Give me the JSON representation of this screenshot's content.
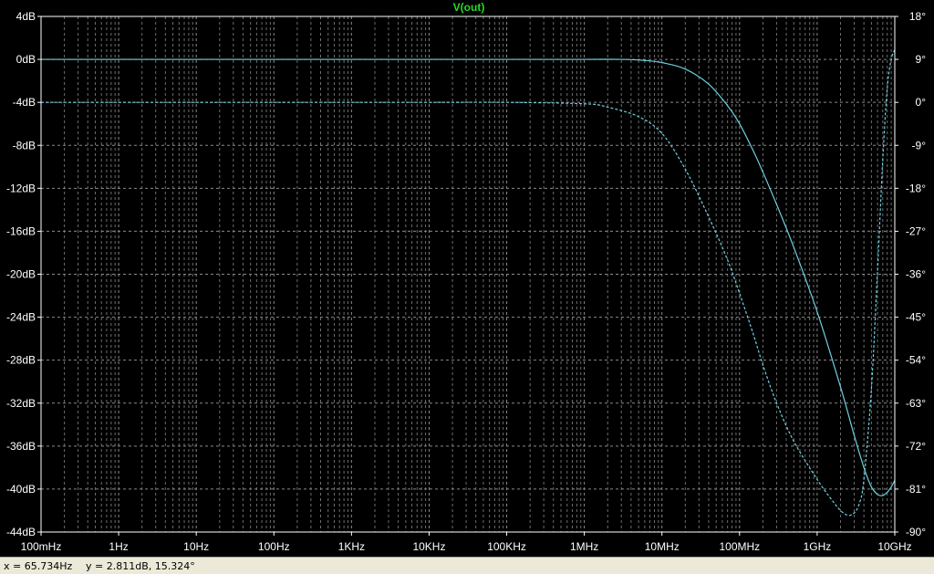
{
  "colors": {
    "background": "#000000",
    "axis": "#ffffff",
    "grid": "#8a8a8a",
    "trace": "#6fcfe0",
    "title": "#22dd22"
  },
  "status": {
    "x_readout": "x = 65.734Hz",
    "y_readout": "y = 2.811dB, 15.324°"
  },
  "chart_data": {
    "type": "line",
    "title": "V(out)",
    "x_scale": "log",
    "xlim": [
      0.1,
      10000000000
    ],
    "x_ticks": [
      0.1,
      1,
      10,
      100,
      1000,
      10000,
      100000,
      1000000,
      10000000,
      100000000,
      1000000000,
      10000000000
    ],
    "x_tick_labels": [
      "100mHz",
      "1Hz",
      "10Hz",
      "100Hz",
      "1KHz",
      "10KHz",
      "100KHz",
      "1MHz",
      "10MHz",
      "100MHz",
      "1GHz",
      "10GHz"
    ],
    "ylim": [
      -44,
      4
    ],
    "y_ticks": [
      4,
      0,
      -4,
      -8,
      -12,
      -16,
      -20,
      -24,
      -28,
      -32,
      -36,
      -40,
      -44
    ],
    "y_tick_labels": [
      "4dB",
      "0dB",
      "-4dB",
      "-8dB",
      "-12dB",
      "-16dB",
      "-20dB",
      "-24dB",
      "-28dB",
      "-32dB",
      "-36dB",
      "-40dB",
      "-44dB"
    ],
    "y2lim": [
      -90,
      18
    ],
    "y2_ticks": [
      18,
      9,
      0,
      -9,
      -18,
      -27,
      -36,
      -45,
      -54,
      -63,
      -72,
      -81,
      -90
    ],
    "y2_tick_labels": [
      "18°",
      "9°",
      "0°",
      "-9°",
      "-18°",
      "-27°",
      "-36°",
      "-45°",
      "-54°",
      "-63°",
      "-72°",
      "-81°",
      "-90°"
    ],
    "grid": true,
    "series": [
      {
        "axis": "left",
        "style": "solid",
        "x": [
          0.1,
          1,
          10,
          100,
          1000,
          10000,
          100000,
          1000000,
          3000000,
          6000000,
          10000000,
          20000000,
          40000000,
          70000000,
          100000000,
          150000000,
          200000000,
          300000000,
          500000000,
          1000000000,
          2000000000,
          3000000000,
          4000000000,
          5000000000,
          6000000000,
          7000000000,
          8000000000,
          9000000000,
          10000000000
        ],
        "y": [
          0,
          0,
          0,
          0,
          0,
          0,
          0,
          0,
          0,
          -0.1,
          -0.3,
          -0.9,
          -2.3,
          -4.3,
          -6.0,
          -8.5,
          -10.5,
          -13.5,
          -17.5,
          -23.5,
          -30.5,
          -35.0,
          -38.0,
          -39.8,
          -40.5,
          -40.6,
          -40.3,
          -39.8,
          -39.2
        ]
      },
      {
        "axis": "right",
        "style": "dashed",
        "x": [
          0.1,
          1,
          10,
          100,
          1000,
          10000,
          100000,
          1000000,
          2000000,
          5000000,
          10000000,
          20000000,
          40000000,
          70000000,
          100000000,
          150000000,
          200000000,
          300000000,
          500000000,
          1000000000,
          1500000000,
          2000000000,
          2500000000,
          3000000000,
          3500000000,
          4000000000,
          5000000000,
          6000000000,
          7000000000,
          8000000000,
          9000000000,
          10000000000
        ],
        "y": [
          0,
          0,
          0,
          0,
          0,
          0,
          0,
          -0.3,
          -1.0,
          -3.0,
          -6.5,
          -14.0,
          -24.0,
          -33.0,
          -40.0,
          -48.5,
          -55.0,
          -63.0,
          -71.0,
          -79.0,
          -83.0,
          -85.5,
          -86.5,
          -86.0,
          -84.0,
          -79.0,
          -60.0,
          -35.0,
          -12.0,
          3.0,
          9.0,
          11.0
        ]
      }
    ]
  }
}
